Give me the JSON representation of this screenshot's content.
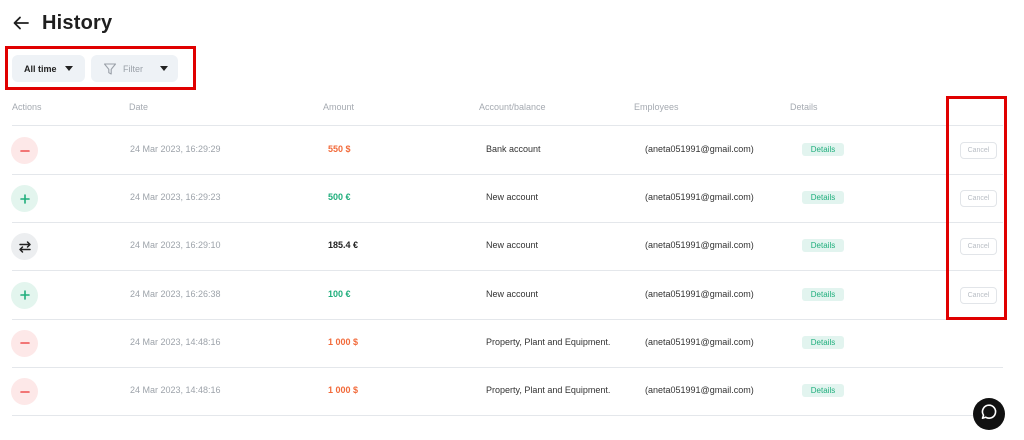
{
  "header": {
    "title": "History"
  },
  "filters": {
    "time_label": "All time",
    "filter_placeholder": "Filter"
  },
  "table": {
    "columns": [
      "Actions",
      "Date",
      "Amount",
      "Account/balance",
      "Employees",
      "Details"
    ],
    "rows": [
      {
        "action": "minus",
        "date": "24 Mar 2023, 16:29:29",
        "amount": "550 $",
        "amount_kind": "negative",
        "account": "Bank account",
        "employee": "(aneta051991@gmail.com)",
        "details": "Details",
        "cancel": "Cancel"
      },
      {
        "action": "plus",
        "date": "24 Mar 2023, 16:29:23",
        "amount": "500 €",
        "amount_kind": "positive",
        "account": "New account",
        "employee": "(aneta051991@gmail.com)",
        "details": "Details",
        "cancel": "Cancel"
      },
      {
        "action": "transfer",
        "date": "24 Mar 2023, 16:29:10",
        "amount": "185.4 €",
        "amount_kind": "neutral",
        "account": "New account",
        "employee": "(aneta051991@gmail.com)",
        "details": "Details",
        "cancel": "Cancel"
      },
      {
        "action": "plus",
        "date": "24 Mar 2023, 16:26:38",
        "amount": "100 €",
        "amount_kind": "positive",
        "account": "New account",
        "employee": "(aneta051991@gmail.com)",
        "details": "Details",
        "cancel": "Cancel"
      },
      {
        "action": "minus",
        "date": "24 Mar 2023, 14:48:16",
        "amount": "1 000 $",
        "amount_kind": "negative",
        "account": "Property, Plant and Equipment.",
        "employee": "(aneta051991@gmail.com)",
        "details": "Details",
        "cancel": ""
      },
      {
        "action": "minus",
        "date": "24 Mar 2023, 14:48:16",
        "amount": "1 000 $",
        "amount_kind": "negative",
        "account": "Property, Plant and Equipment.",
        "employee": "(aneta051991@gmail.com)",
        "details": "Details",
        "cancel": ""
      }
    ]
  },
  "icons": {
    "back": "arrow-left-icon",
    "filter": "funnel-icon",
    "chat": "chat-bubble-icon",
    "minus": "minus-icon",
    "plus": "plus-icon",
    "transfer": "transfer-arrows-icon"
  },
  "colors": {
    "negative": "#f26a3a",
    "positive": "#1fae7c",
    "highlight": "#e00000"
  }
}
